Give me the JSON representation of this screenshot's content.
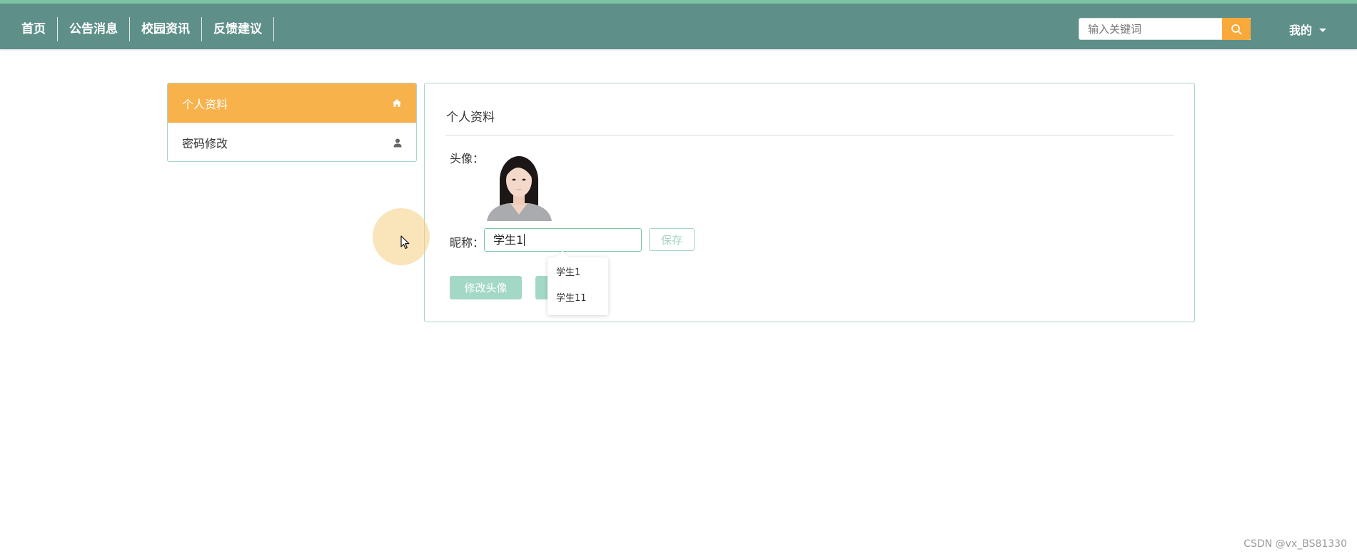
{
  "nav": {
    "items": [
      "首页",
      "公告消息",
      "校园资讯",
      "反馈建议"
    ],
    "search_placeholder": "输入关键词",
    "mine_label": "我的"
  },
  "sidebar": {
    "items": [
      {
        "label": "个人资料",
        "icon": "home-icon",
        "active": true
      },
      {
        "label": "密码修改",
        "icon": "user-icon",
        "active": false
      }
    ]
  },
  "profile": {
    "title": "个人资料",
    "avatar_label": "头像：",
    "nickname_label": "昵称：",
    "nickname_value": "学生1",
    "save_label": "保存",
    "change_avatar_label": "修改头像"
  },
  "autocomplete": {
    "options": [
      "学生1",
      "学生11"
    ]
  },
  "colors": {
    "nav_bg": "#5e8f89",
    "accent_orange": "#f8b24b",
    "accent_green": "#a4d8c6",
    "border_green": "#a9d4c8"
  },
  "watermark": "CSDN @vx_BS81330"
}
